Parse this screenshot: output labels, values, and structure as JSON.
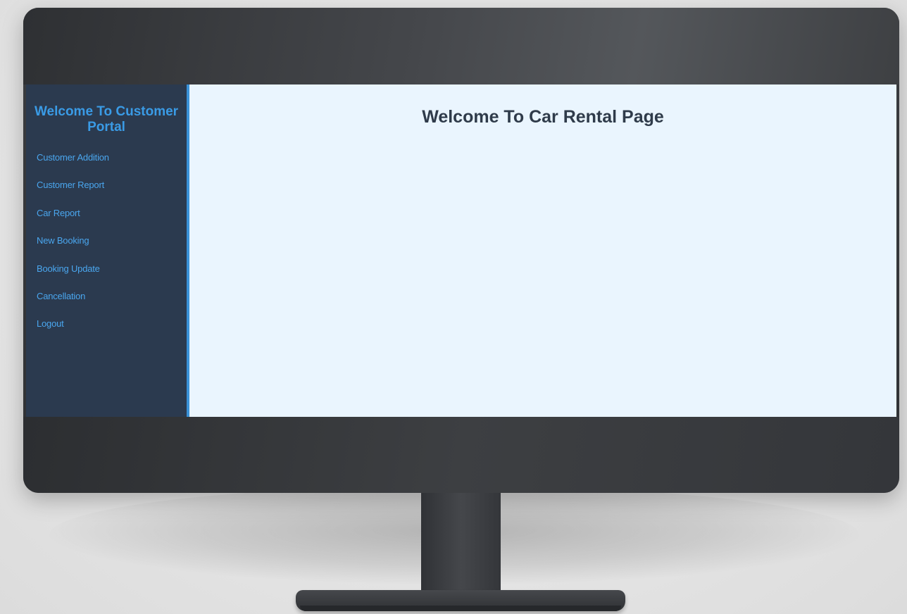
{
  "sidebar": {
    "title": "Welcome To Customer Portal",
    "items": [
      {
        "label": "Customer Addition"
      },
      {
        "label": "Customer Report"
      },
      {
        "label": "Car Report"
      },
      {
        "label": "New Booking"
      },
      {
        "label": "Booking Update"
      },
      {
        "label": "Cancellation"
      },
      {
        "label": "Logout"
      }
    ]
  },
  "main": {
    "title": "Welcome To Car Rental Page"
  },
  "colors": {
    "sidebar_bg": "#2b3a4f",
    "accent": "#3a92d8",
    "link": "#4aa6ee",
    "main_bg": "#eaf5fe",
    "title_text": "#2f3b4a"
  }
}
